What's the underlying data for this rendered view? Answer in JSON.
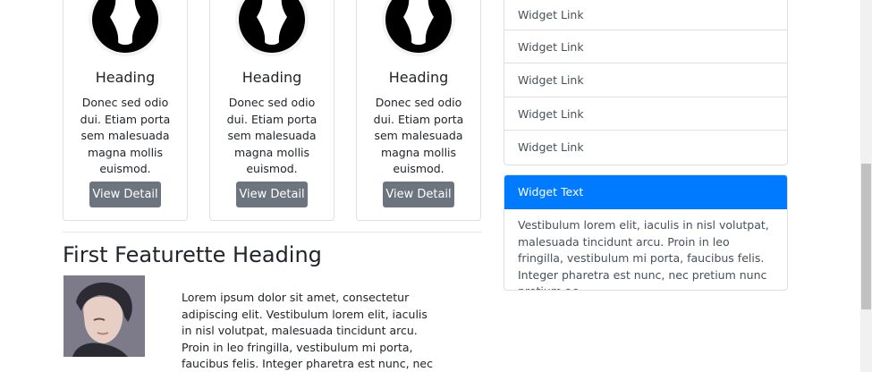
{
  "cards": [
    {
      "heading": "Heading",
      "text": "Donec sed odio dui. Etiam porta sem malesuada magna mollis euismod.",
      "button_label": "View Detail"
    },
    {
      "heading": "Heading",
      "text": "Donec sed odio dui. Etiam porta sem malesuada magna mollis euismod.",
      "button_label": "View Detail"
    },
    {
      "heading": "Heading",
      "text": "Donec sed odio dui. Etiam porta sem malesuada magna mollis euismod.",
      "button_label": "View Detail"
    }
  ],
  "featurette": {
    "heading": "First Featurette Heading",
    "text": "Lorem ipsum dolor sit amet, consectetur adipiscing elit. Vestibulum lorem elit, iaculis in nisl volutpat, malesuada tincidunt arcu. Proin in leo fringilla, vestibulum mi porta, faucibus felis. Integer pharetra est nunc, nec pretium nunc pretium ac."
  },
  "sidebar": {
    "links": [
      "Widget Link",
      "Widget Link",
      "Widget Link",
      "Widget Link",
      "Widget Link"
    ],
    "widget_card": {
      "header": "Widget Text",
      "body": "Vestibulum lorem elit, iaculis in nisl volutpat, malesuada tincidunt arcu. Proin in leo fringilla, vestibulum mi porta, faucibus felis. Integer pharetra est nunc, nec pretium nunc pretium ac."
    }
  },
  "colors": {
    "primary": "#007bff",
    "secondary_button": "#6c757d",
    "border": "#dfdfdf"
  },
  "icons": {
    "card_avatar": "person-silhouette-icon"
  }
}
